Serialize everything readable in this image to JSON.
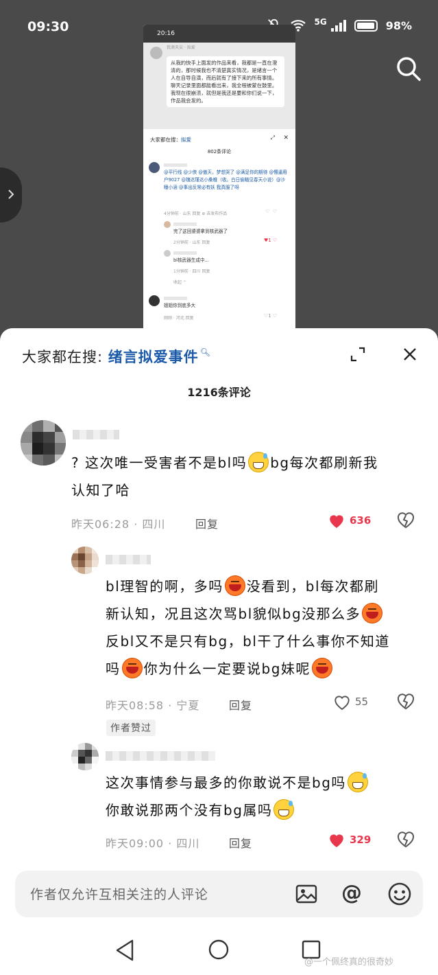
{
  "status_bar": {
    "time": "09:30",
    "network": "5G",
    "battery": "98%"
  },
  "embedded": {
    "time": "20:16",
    "chat_title": "我滴天尖 · 拟爱",
    "bubble": "从我的快手上面发的作品来看，我都是一直在澄清的，那时候我也不清楚真实情况，是绪言一个人在自导自演，而后就有了接下来的所有事情。聊天记录里面都能看出来，我全程被蒙在鼓里。我现在很崩溃，就但是我还是要和你们说一下，作品我会发的。",
    "search_label": "大家都在搜：",
    "search_term": "拟爱",
    "comment_count": "802条评论",
    "c1_text_1": "@平行线 @少侠 @傲天，梦想哭了 @满足你的期待 @懵逼用户9027 @瑰达瑾达小桑椎（收。白日偷瞄见春天小说）@沙瞳小涵 @事出反常必有妖 我真服了呀",
    "c1_meta": "4分钟前 · 山东   回复   ⊕ 去发布作品",
    "c2_text": "完了这回婆婆拿到核武器了",
    "c2_meta": "2分钟前 · 山东   回复",
    "c3_text": "bl核武器生成中...",
    "c3_meta": "1分钟前 · 四川   回复",
    "collapse": "收起 ⌃",
    "c4_text": "姐姐你到底多大",
    "c4_meta": "刚刚 · 河北   回复",
    "c2_likes": "1",
    "c4_likes": "1"
  },
  "sheet": {
    "search_label": "大家都在搜:",
    "search_term": "绪言拟爱事件",
    "comment_count": "1216条评论"
  },
  "comments": [
    {
      "text_a": "? 这次唯一受害者不是bl吗",
      "text_b": "bg每次都刷新我",
      "text_c": "认知了哈",
      "meta": "昨天06:28 · 四川",
      "reply": "回复",
      "likes": "636",
      "liked": true
    },
    {
      "line1_a": "bl理智的啊，多吗",
      "line1_b": "没看到，bl每次都刷",
      "line2": "新认知，况且这次骂bl貌似bg没那么多",
      "line3": "反bl又不是只有bg，bl干了什么事你不知道",
      "line4_a": "吗",
      "line4_b": "你为什么一定要说bg妹呢",
      "meta": "昨天08:58 · 宁夏",
      "reply": "回复",
      "likes": "55",
      "liked": false,
      "badge": "作者赞过"
    },
    {
      "line1": "这次事情参与最多的你敢说不是bg吗",
      "line2": "你敢说那两个没有bg属吗",
      "meta": "昨天09:00 · 四川",
      "reply": "回复",
      "likes": "329",
      "liked": true
    }
  ],
  "input": {
    "placeholder": "作者仅允许互相关注的人评论"
  },
  "watermark": "@一个佩终真的很奇妙",
  "colors": {
    "accent_blue": "#1a5aa8",
    "like_red": "#e8364c",
    "background": "#4a4a4a"
  },
  "icons": [
    "search-icon",
    "expand-icon",
    "close-icon",
    "heart-icon",
    "dislike-icon",
    "image-icon",
    "at-icon",
    "emoji-icon",
    "nav-back-icon",
    "nav-home-icon",
    "nav-recents-icon",
    "chevron-right-icon"
  ]
}
